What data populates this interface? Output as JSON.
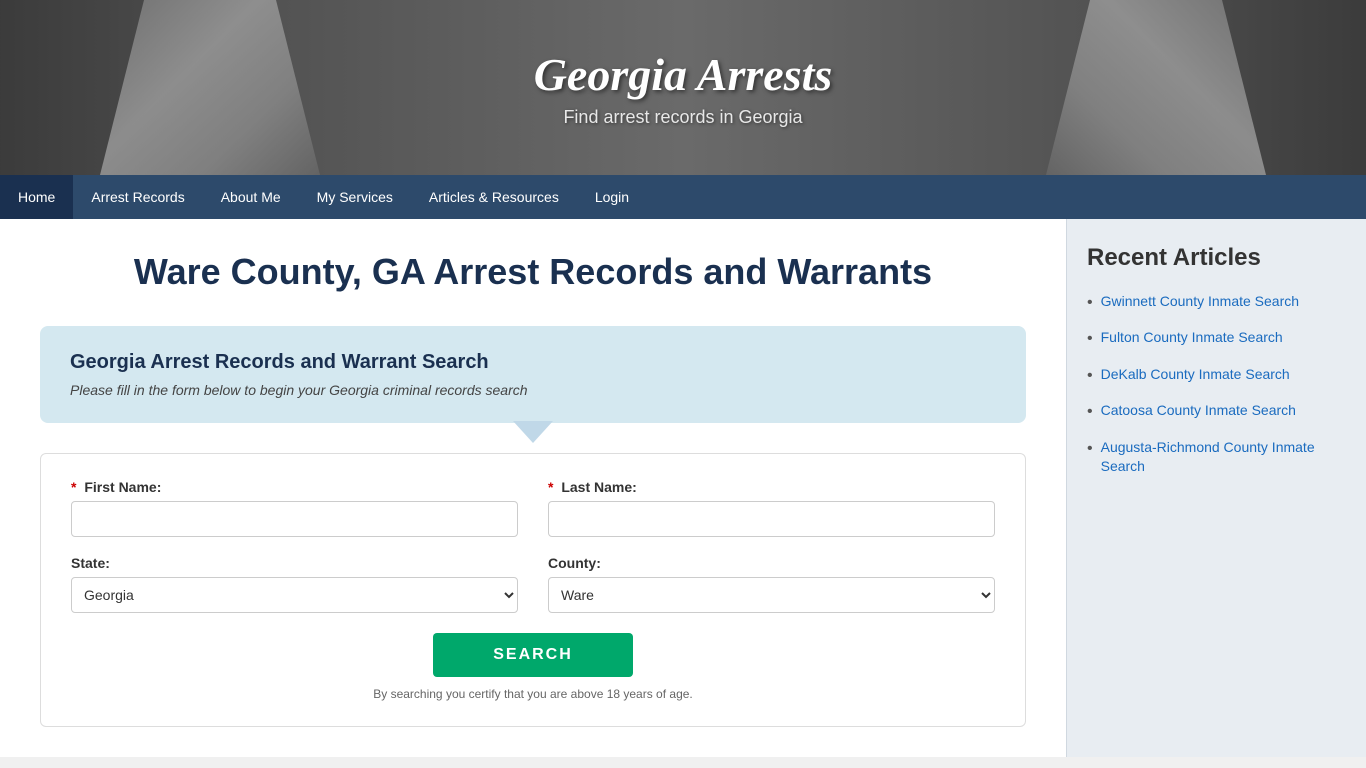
{
  "header": {
    "title": "Georgia Arrests",
    "subtitle": "Find arrest records in Georgia"
  },
  "nav": {
    "items": [
      {
        "label": "Home",
        "href": "#",
        "active": true
      },
      {
        "label": "Arrest Records",
        "href": "#"
      },
      {
        "label": "About Me",
        "href": "#"
      },
      {
        "label": "My Services",
        "href": "#"
      },
      {
        "label": "Articles & Resources",
        "href": "#"
      },
      {
        "label": "Login",
        "href": "#"
      }
    ]
  },
  "main": {
    "page_title": "Ware County, GA Arrest Records and Warrants",
    "search_box": {
      "title": "Georgia Arrest Records and Warrant Search",
      "subtitle": "Please fill in the form below to begin your Georgia criminal records search"
    },
    "form": {
      "first_name_label": "First Name:",
      "last_name_label": "Last Name:",
      "state_label": "State:",
      "county_label": "County:",
      "state_value": "Georgia",
      "county_value": "Ware",
      "search_button": "SEARCH",
      "form_note": "By searching you certify that you are above 18 years of age.",
      "required_star": "*"
    }
  },
  "sidebar": {
    "title": "Recent Articles",
    "articles": [
      {
        "label": "Gwinnett County Inmate Search",
        "href": "#"
      },
      {
        "label": "Fulton County Inmate Search",
        "href": "#"
      },
      {
        "label": "DeKalb County Inmate Search",
        "href": "#"
      },
      {
        "label": "Catoosa County Inmate Search",
        "href": "#"
      },
      {
        "label": "Augusta-Richmond County Inmate Search",
        "href": "#"
      }
    ]
  }
}
